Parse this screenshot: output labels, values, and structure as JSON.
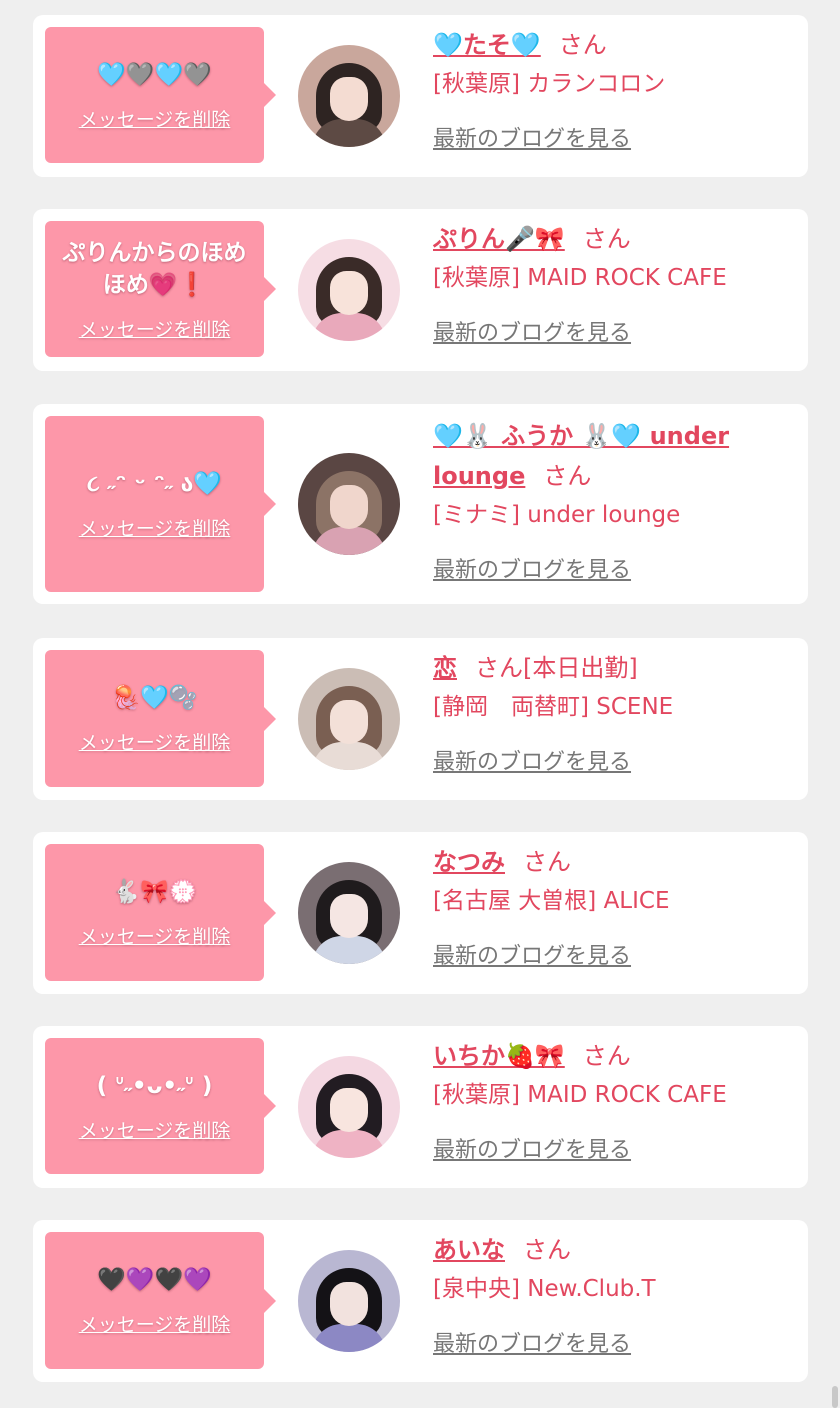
{
  "delete_label": "メッセージを削除",
  "san_label": "さん",
  "blog_label": "最新のブログを見る",
  "colors": {
    "bubble": "#fd97a9",
    "name": "#e2475f",
    "link_gray": "#777777",
    "card": "#ffffff",
    "background": "#efefef"
  },
  "cards": [
    {
      "message": "🩵🩶🩵🩶",
      "name": "🩵たそ🩵",
      "status": "",
      "shop": "[秋葉原] カランコロン",
      "avatar_colors": {
        "bg": "#c9a79c",
        "hair": "#2e2422",
        "face": "#f4dcd2",
        "body": "#5d4a44"
      }
    },
    {
      "message": "ぷりんからのほめほめ💗❗️",
      "name": "ぷりん🎤🎀",
      "status": "",
      "shop": "[秋葉原] MAID ROCK CAFE",
      "avatar_colors": {
        "bg": "#f6dde4",
        "hair": "#3a2b28",
        "face": "#f8e3da",
        "body": "#e9a9bb"
      }
    },
    {
      "message": "૮ ˶ᵔ ᵕ ᵔ˶ ა🩵",
      "name": "🩵🐰 ふうか 🐰🩵 under lounge",
      "status": "",
      "shop": "[ミナミ] under lounge",
      "avatar_colors": {
        "bg": "#5a4643",
        "hair": "#8c7366",
        "face": "#f0d6cc",
        "body": "#d9a2b2"
      }
    },
    {
      "message": "🪼🩵🫧",
      "name": "恋",
      "status": "[本日出勤]",
      "shop": "[静岡　両替町] SCENE",
      "avatar_colors": {
        "bg": "#cbbdb5",
        "hair": "#7a5f52",
        "face": "#f3e0d8",
        "body": "#e8dcd6"
      }
    },
    {
      "message": "🐇🎀💮",
      "name": "なつみ",
      "status": "",
      "shop": "[名古屋 大曽根] ALICE",
      "avatar_colors": {
        "bg": "#7a6e72",
        "hair": "#1f1b1d",
        "face": "#f5e6e3",
        "body": "#cfd6e6"
      }
    },
    {
      "message": "( ᐡ˶•ᴗ•˶ᐡ )",
      "name": "いちか🍓🎀",
      "status": "",
      "shop": "[秋葉原] MAID ROCK CAFE",
      "avatar_colors": {
        "bg": "#f4d8e2",
        "hair": "#221c22",
        "face": "#f8e5df",
        "body": "#efb3c4"
      }
    },
    {
      "message": "🖤💜🖤💜",
      "name": "あいな",
      "status": "",
      "shop": "[泉中央] New.Club.T",
      "avatar_colors": {
        "bg": "#b9b7d2",
        "hair": "#141216",
        "face": "#f2e2de",
        "body": "#8c88c4"
      }
    }
  ]
}
